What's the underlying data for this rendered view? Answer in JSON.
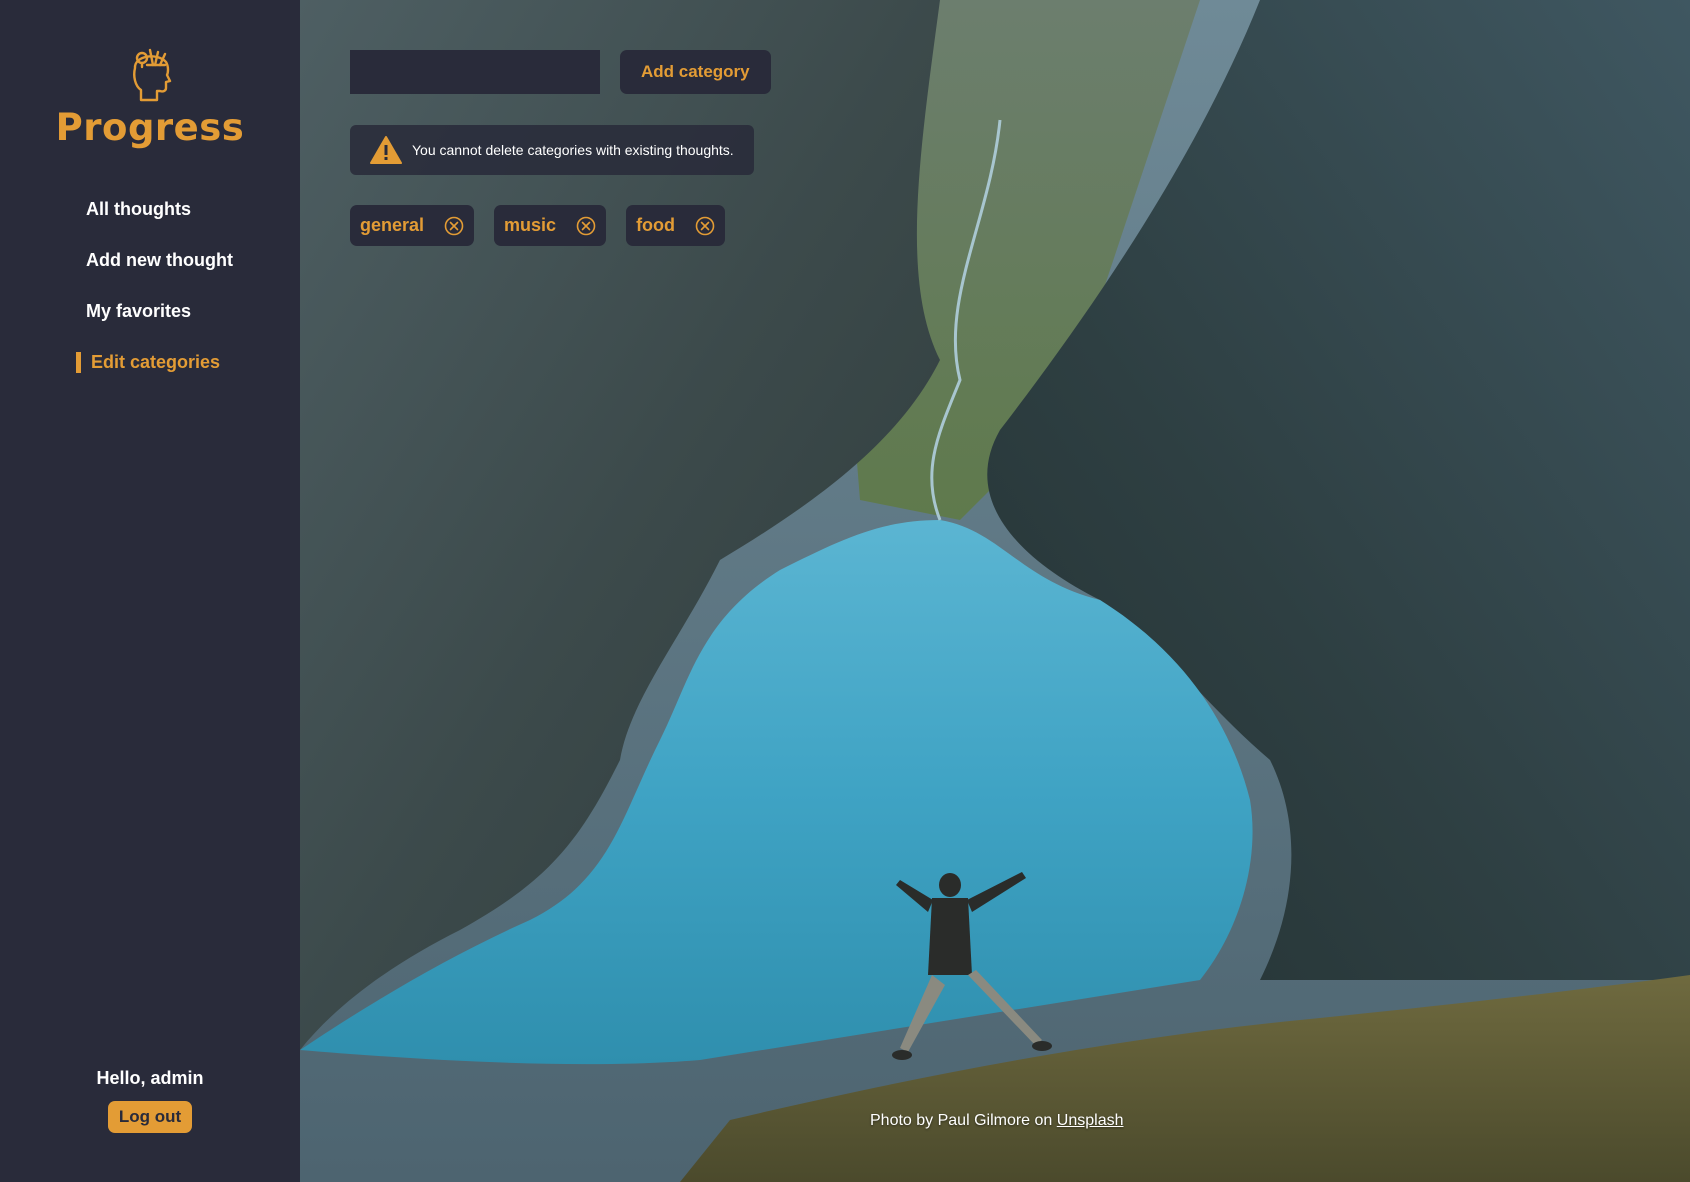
{
  "brand": {
    "name": "Progress",
    "logo_icon": "head-with-ideas-icon"
  },
  "nav": {
    "items": [
      {
        "label": "All thoughts",
        "active": false
      },
      {
        "label": "Add new thought",
        "active": false
      },
      {
        "label": "My favorites",
        "active": false
      },
      {
        "label": "Edit categories",
        "active": true
      }
    ]
  },
  "user": {
    "greeting": "Hello, admin",
    "logout_label": "Log out"
  },
  "add_category": {
    "input_value": "",
    "button_label": "Add category"
  },
  "warning": {
    "icon": "warning-triangle-icon",
    "text": "You cannot delete categories with existing thoughts."
  },
  "categories": [
    {
      "label": "general",
      "delete_icon": "circle-x-icon"
    },
    {
      "label": "music",
      "delete_icon": "circle-x-icon"
    },
    {
      "label": "food",
      "delete_icon": "circle-x-icon"
    }
  ],
  "credit": {
    "prefix": "Photo by Paul Gilmore on",
    "link_label": "Unsplash"
  },
  "colors": {
    "sidebar_bg": "#292b3a",
    "accent": "#e39c35",
    "text_light": "#ffffff"
  }
}
